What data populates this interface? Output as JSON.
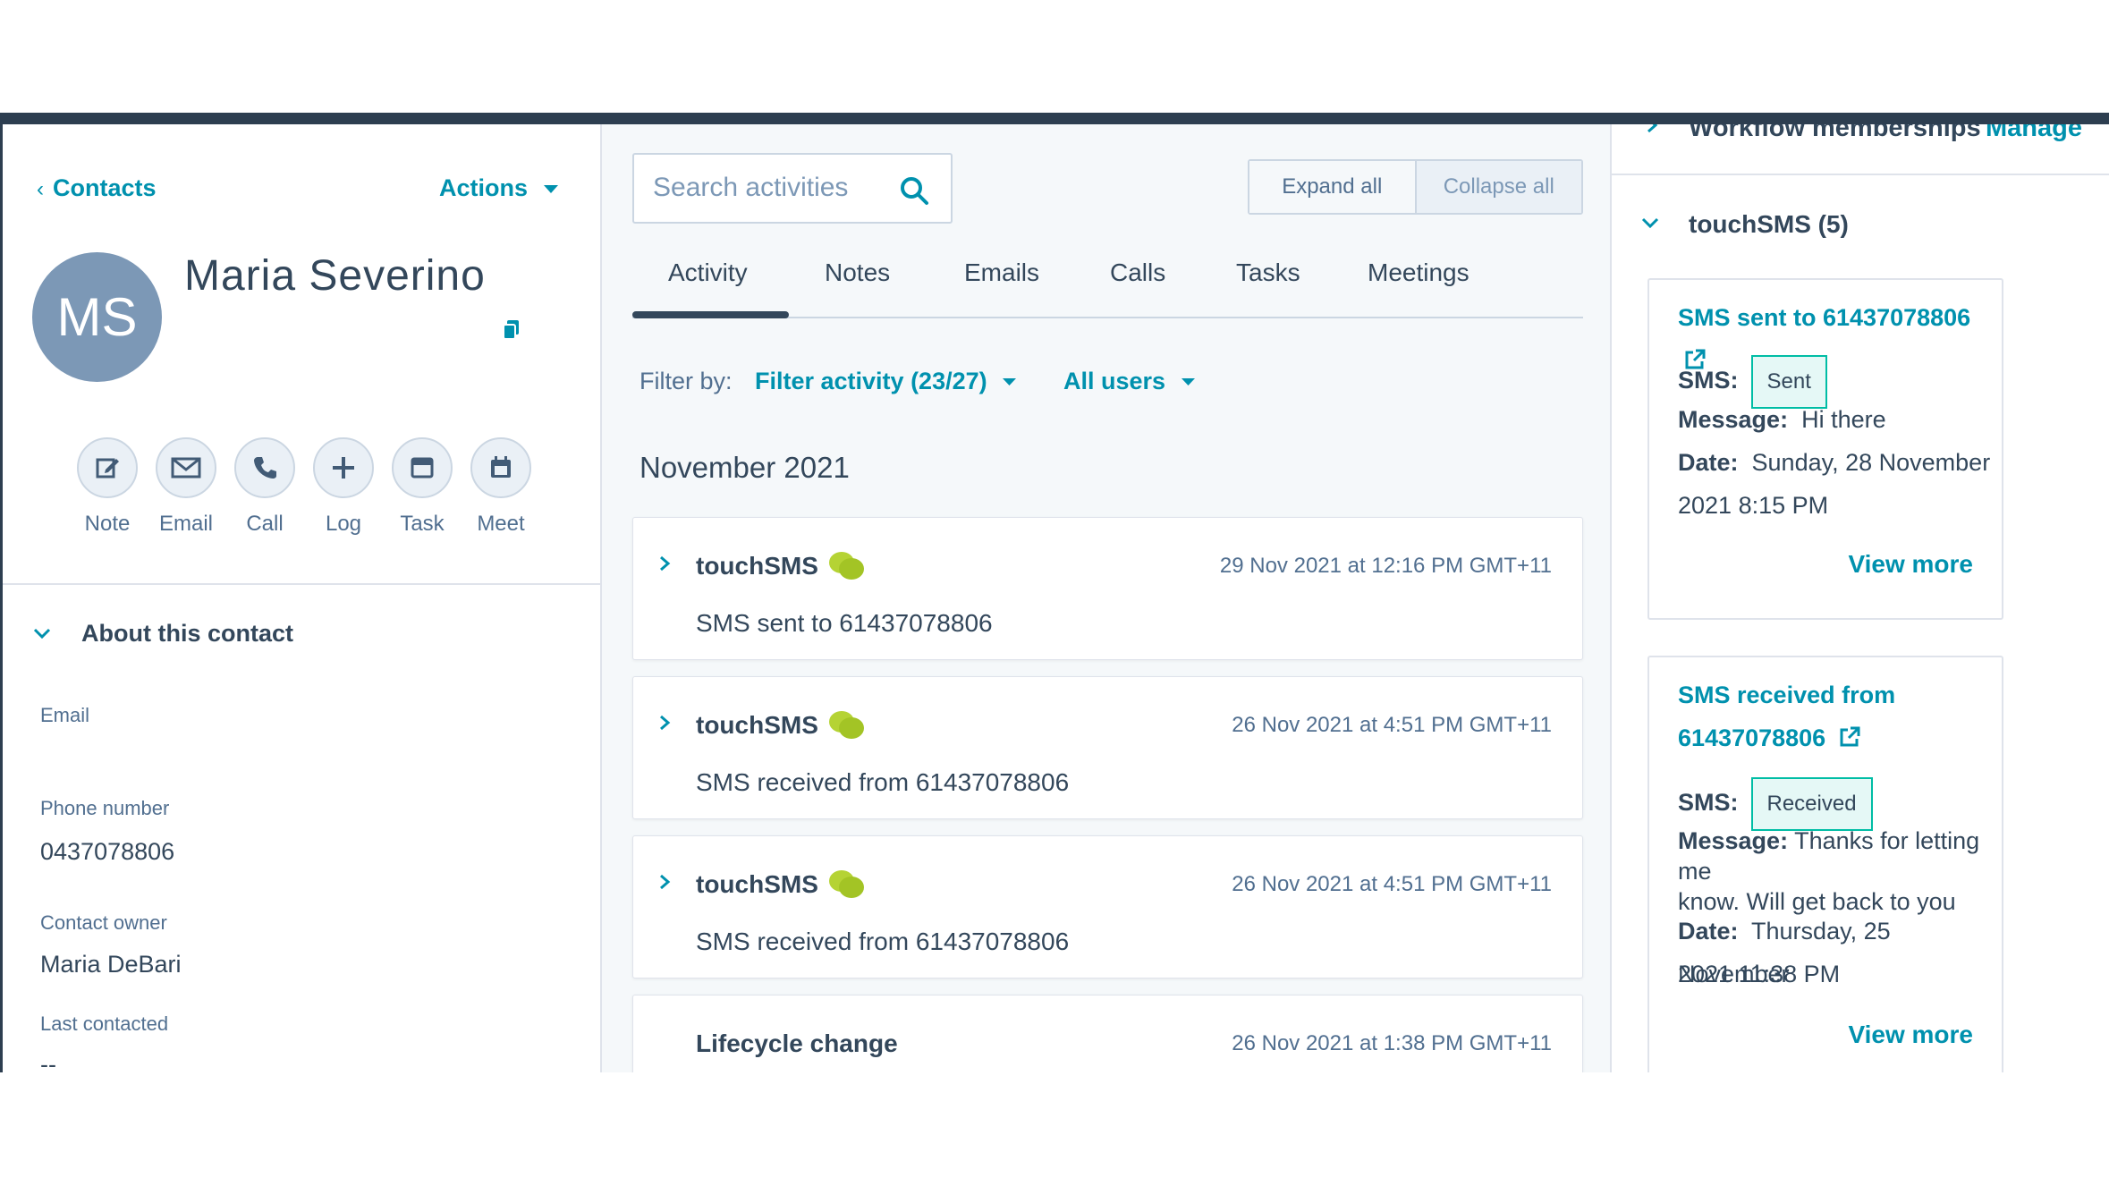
{
  "left": {
    "back_label": "Contacts",
    "actions_label": "Actions",
    "avatar_initials": "MS",
    "contact_name": "Maria Severino",
    "quick_actions": [
      "Note",
      "Email",
      "Call",
      "Log",
      "Task",
      "Meet"
    ],
    "about_title": "About this contact",
    "properties": [
      {
        "label": "Email",
        "value": ""
      },
      {
        "label": "Phone number",
        "value": "0437078806"
      },
      {
        "label": "Contact owner",
        "value": "Maria DeBari"
      },
      {
        "label": "Last contacted",
        "value": "--"
      }
    ]
  },
  "middle": {
    "search_placeholder": "Search activities",
    "expand_all": "Expand all",
    "collapse_all": "Collapse all",
    "tabs": [
      "Activity",
      "Notes",
      "Emails",
      "Calls",
      "Tasks",
      "Meetings"
    ],
    "active_tab": "Activity",
    "filter_by_label": "Filter by:",
    "filter_activity": "Filter activity (23/27)",
    "all_users": "All users",
    "month_heading": "November 2021",
    "activities": [
      {
        "title": "touchSMS",
        "date": "29 Nov 2021 at 12:16 PM GMT+11",
        "body": "SMS sent to 61437078806"
      },
      {
        "title": "touchSMS",
        "date": "26 Nov 2021 at 4:51 PM GMT+11",
        "body": "SMS received from 61437078806"
      },
      {
        "title": "touchSMS",
        "date": "26 Nov 2021 at 4:51 PM GMT+11",
        "body": "SMS received from 61437078806"
      },
      {
        "title": "Lifecycle change",
        "date": "26 Nov 2021 at 1:38 PM GMT+11",
        "body": ""
      }
    ]
  },
  "right": {
    "workflow_label": "Workflow memberships",
    "manage_label": "Manage",
    "section_title": "touchSMS (5)",
    "cards": [
      {
        "title_line1": "SMS sent to 61437078806",
        "title_line2": "",
        "sms_label": "SMS:",
        "status": "Sent",
        "message_label": "Message:",
        "message_line1": "Hi there",
        "message_line2": "",
        "date_label": "Date:",
        "date_line1": "Sunday, 28 November",
        "date_line2": "2021 8:15 PM",
        "view_more": "View more"
      },
      {
        "title_line1": "SMS received from",
        "title_line2": "61437078806",
        "sms_label": "SMS:",
        "status": "Received",
        "message_label": "Message:",
        "message_line1": "Thanks for letting me",
        "message_line2": "know. Will get back to you",
        "date_label": "Date:",
        "date_line1": "Thursday, 25 November",
        "date_line2": "2021 11:38 PM",
        "view_more": "View more"
      }
    ]
  },
  "colors": {
    "accent_teal": "#0091ae",
    "text_dark": "#33475b",
    "avatar_bg": "#7c98b6",
    "topbar": "#2d3e50",
    "badge_border": "#00bda5",
    "sms_icon_green": "#b5d334"
  }
}
